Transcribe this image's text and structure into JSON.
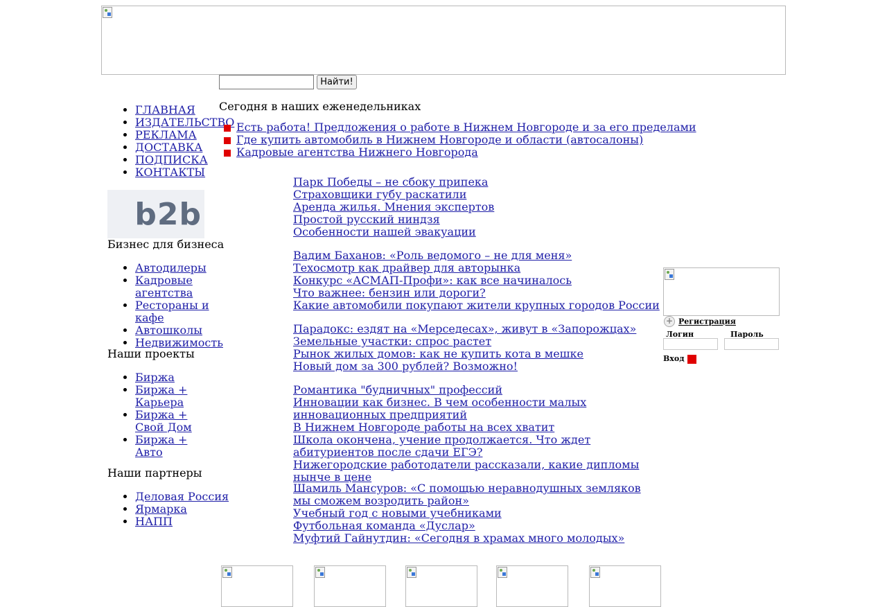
{
  "search": {
    "placeholder": "",
    "value": "",
    "button_label": "Найти!"
  },
  "main_menu": [
    "ГЛАВНАЯ",
    "ИЗДАТЕЛЬСТВО",
    "РЕКЛАМА",
    "ДОСТАВКА",
    "ПОДПИСКА",
    "КОНТАКТЫ"
  ],
  "b2b": {
    "logo_text": "b2b",
    "heading": "Бизнес для бизнеса",
    "items": [
      "Автодилеры",
      "Кадровые агентства",
      "Рестораны и кафе",
      "Автошколы",
      "Недвижимость"
    ]
  },
  "projects": {
    "heading": "Наши проекты",
    "items": [
      "Биржа",
      "Биржа + Карьера",
      "Биржа + Свой Дом",
      "Биржа + Авто"
    ]
  },
  "partners": {
    "heading": "Наши партнеры",
    "items": [
      "Деловая Россия",
      "Ярмарка",
      "НАПП"
    ]
  },
  "weekly": {
    "title": "Сегодня в наших еженедельниках",
    "items": [
      "Есть работа! Предложения о работе в Нижнем Новгороде и за его пределами",
      "Где купить автомобиль в Нижнем Новгороде и области (автосалоны)",
      "Кадровые агентства Нижнего Новгорода"
    ]
  },
  "news_groups": [
    [
      "Парк Победы – не сбоку припека",
      "Страховщики губу раскатили",
      "Аренда жилья. Мнения экспертов",
      "Простой русский ниндзя",
      "Особенности нашей эвакуации"
    ],
    [
      "Вадим Баханов: «Роль ведомого – не для меня»",
      "Техосмотр как драйвер для авторынка",
      "Конкурс «АСМАП-Профи»: как все начиналось",
      "Что важнее: бензин или дороги?",
      "Какие автомобили покупают жители крупных городов России"
    ],
    [
      "Парадокс: ездят на «Мерседесах», живут в «Запорожцах»",
      "Земельные участки: спрос растет",
      "Рынок жилых домов: как не купить кота в мешке",
      "Новый дом за 300 рублей? Возможно!"
    ],
    [
      "Романтика \"будничных\" профессий",
      "Инновации как бизнес. В чем особенности малых инновационных предприятий",
      "В Нижнем Новгороде работы на всех хватит",
      "Школа окончена, учение продолжается. Что ждет абитуриентов после сдачи ЕГЭ?",
      "Нижегородские работодатели рассказали, какие дипломы нынче в цене"
    ],
    [
      "Шамиль Мансуров: «С помощью неравнодушных земляков мы сможем возродить район»",
      "Учебный год с новыми учебниками",
      "Футбольная команда «Дуслар»",
      "Муфтий Гайнутдин: «Сегодня в храмах много молодых»"
    ]
  ],
  "login": {
    "register_label": "Регистрация",
    "login_label": "Логин",
    "password_label": "Пароль",
    "enter_label": "Вход"
  },
  "colors": {
    "link": "#1f1fa8",
    "bullet": "#e00000"
  }
}
